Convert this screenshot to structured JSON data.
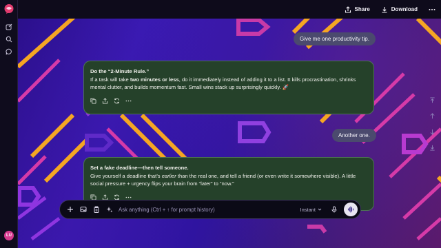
{
  "topbar": {
    "share_label": "Share",
    "download_label": "Download"
  },
  "user": {
    "initials": "LU"
  },
  "messages": {
    "user1": "Give me one productivity tip.",
    "reply1": {
      "heading": "Do the “2-Minute Rule.”",
      "p_before": "If a task will take ",
      "p_bold": "two minutes or less",
      "p_after": ", do it immediately instead of adding it to a list. It kills procrastination, shrinks mental clutter, and builds momentum fast. Small wins stack up surprisingly quickly. 🚀"
    },
    "user2": "Another one.",
    "reply2": {
      "heading": "Set a fake deadline—then tell someone.",
      "p_before": "Give yourself a deadline that’s ",
      "p_italic": "earlier",
      "p_after": " than the real one, and tell a friend (or even write it somewhere visible). A little social pressure + urgency flips your brain from “later” to “now.”"
    }
  },
  "composer": {
    "placeholder": "Ask anything (Ctrl + ↑ for prompt history)",
    "mode": "Instant"
  },
  "colors": {
    "accent_orange": "#f5a623",
    "accent_magenta": "#d63aa8",
    "card_bg": "#25412a"
  }
}
